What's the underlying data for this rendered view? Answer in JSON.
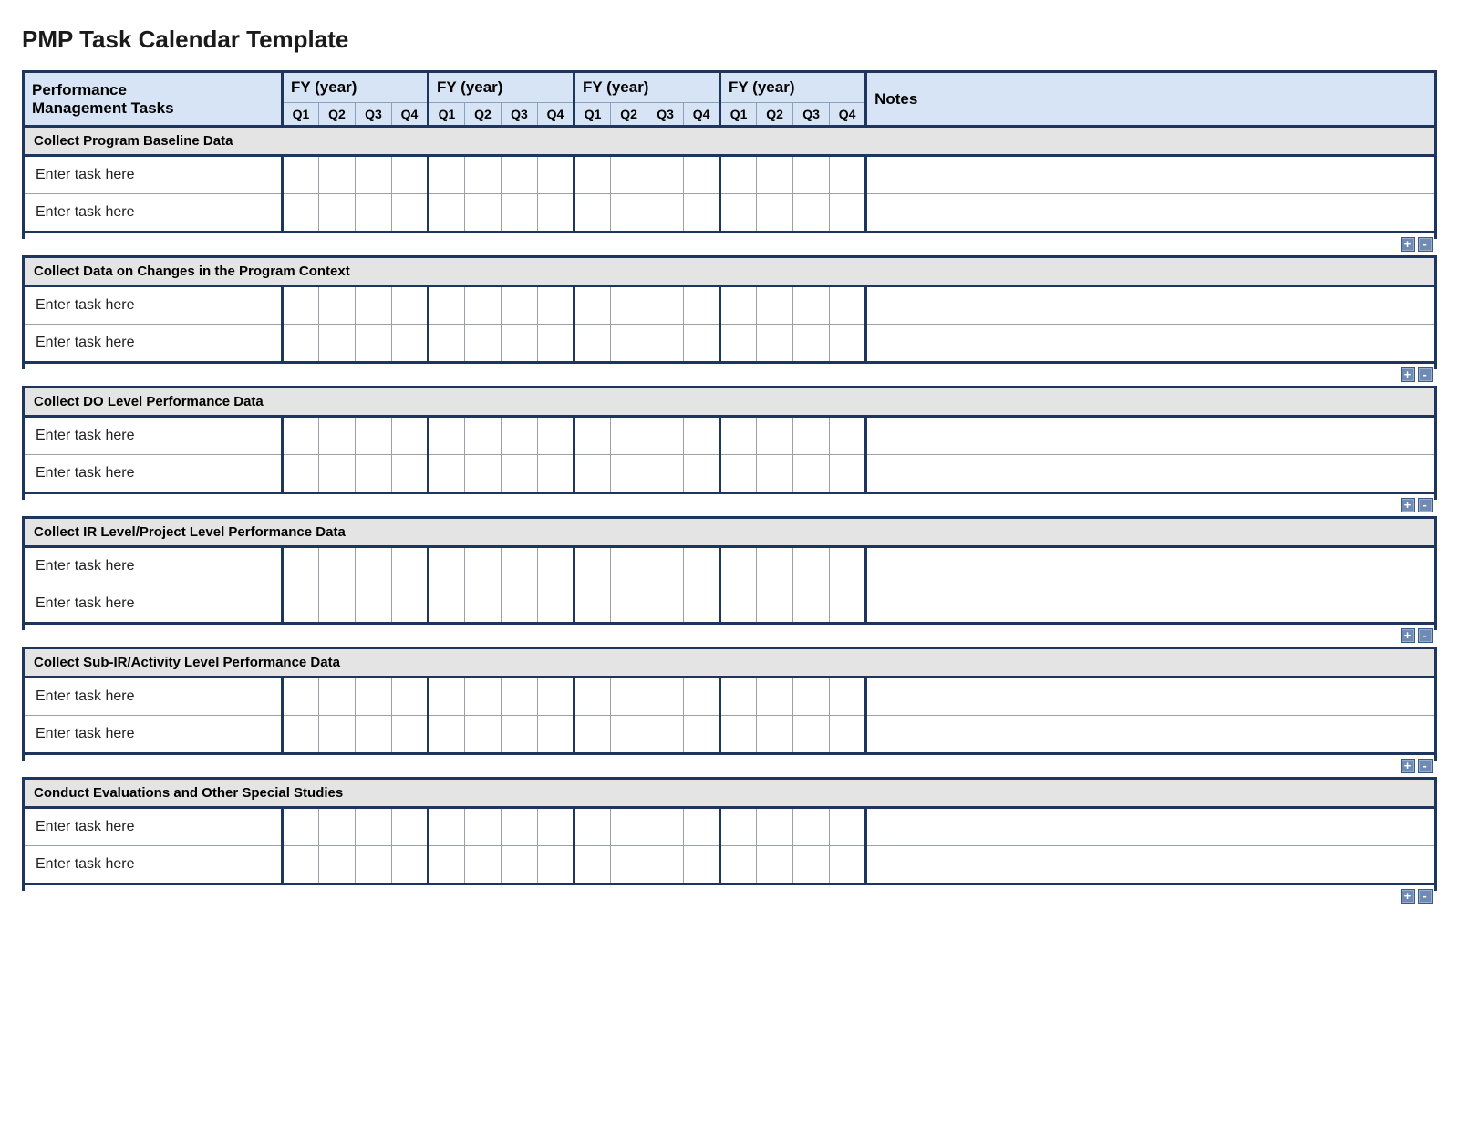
{
  "title": "PMP Task Calendar Template",
  "header": {
    "tasks_col": "Performance Management Tasks",
    "fy_label": "FY  (year)",
    "quarters": [
      "Q1",
      "Q2",
      "Q3",
      "Q4"
    ],
    "fy_count": 4,
    "notes_col": "Notes"
  },
  "task_placeholder": "Enter task here",
  "buttons": {
    "add": "+",
    "remove": "-"
  },
  "sections": [
    {
      "title": "Collect Program Baseline Data",
      "rows": 2
    },
    {
      "title": "Collect Data on Changes in the Program Context",
      "rows": 2
    },
    {
      "title": "Collect DO Level Performance Data",
      "rows": 2
    },
    {
      "title": "Collect IR Level/Project Level Performance Data",
      "rows": 2
    },
    {
      "title": "Collect Sub-IR/Activity Level Performance Data",
      "rows": 2
    },
    {
      "title": "Conduct Evaluations and Other Special Studies",
      "rows": 2
    }
  ]
}
